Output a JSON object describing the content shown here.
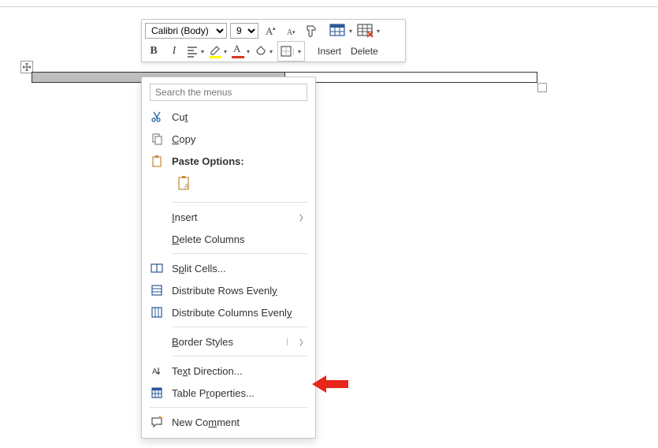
{
  "toolbar": {
    "font_name": "Calibri (Body)",
    "font_size": "9",
    "insert_label": "Insert",
    "delete_label": "Delete"
  },
  "context_menu": {
    "search_placeholder": "Search the menus",
    "cut": "Cut",
    "copy": "Copy",
    "paste_options": "Paste Options:",
    "insert": "Insert",
    "delete_columns": "Delete Columns",
    "split_cells": "Split Cells...",
    "distribute_rows": "Distribute Rows Evenly",
    "distribute_cols": "Distribute Columns Evenly",
    "border_styles": "Border Styles",
    "text_direction": "Text Direction...",
    "table_properties": "Table Properties...",
    "new_comment": "New Comment"
  },
  "colors": {
    "accent_red": "#e8261c",
    "accent_blue": "#2b579a"
  }
}
